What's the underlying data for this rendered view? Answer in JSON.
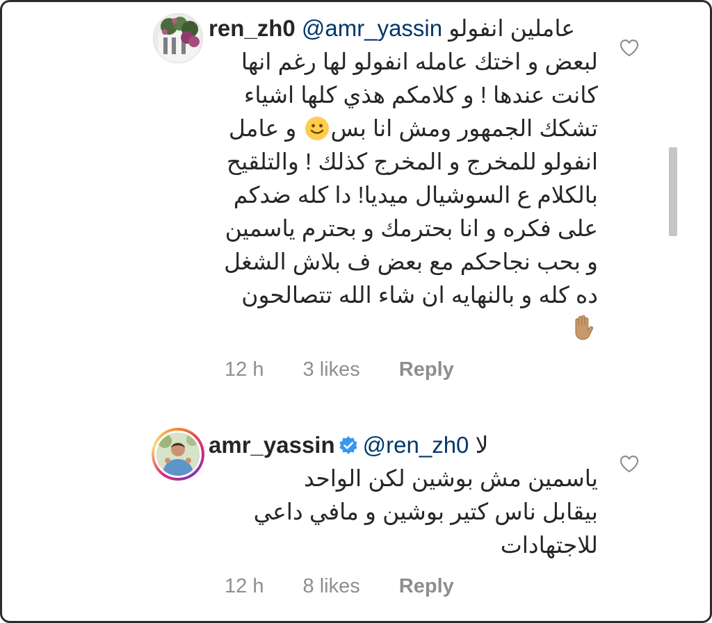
{
  "comments": [
    {
      "username": "ren_zh0",
      "mention": "@amr_yassin",
      "lead_text": "عاملين انفولو",
      "lines": [
        "لبعض و اختك عامله انفولو لها رغم انها",
        "كانت عندها ! و كلامكم هذي كلها اشياء",
        "تشكك الجمهور ومش انا بس",
        "انفولو للمخرج و المخرج كذلك ! والتلقيح",
        "بالكلام ع السوشيال ميديا! دا كله ضدكم",
        "على فكره و انا بحترمك و بحترم ياسمين",
        "و بحب نجاحكم مع بعض ف بلاش الشغل",
        "ده كله و بالنهايه ان شاء الله تتصالحون"
      ],
      "line3_tail": "و عامل",
      "emoji_inline": "slightly-smiling-face-icon",
      "emoji_end": "raised-hand-icon",
      "time": "12 h",
      "likes": "3 likes",
      "reply": "Reply",
      "verified": false
    },
    {
      "username": "amr_yassin",
      "mention": "@ren_zh0",
      "lead_text": "لا",
      "lines": [
        "ياسمين مش بوشين  لكن الواحد",
        "بيقابل ناس كتير بوشين  و مافي داعي",
        "للاجتهادات"
      ],
      "time": "12 h",
      "likes": "8 likes",
      "reply": "Reply",
      "verified": true
    }
  ],
  "colors": {
    "text": "#262626",
    "meta": "#8e8e8e",
    "mention": "#00376b",
    "verified": "#3897f0"
  }
}
